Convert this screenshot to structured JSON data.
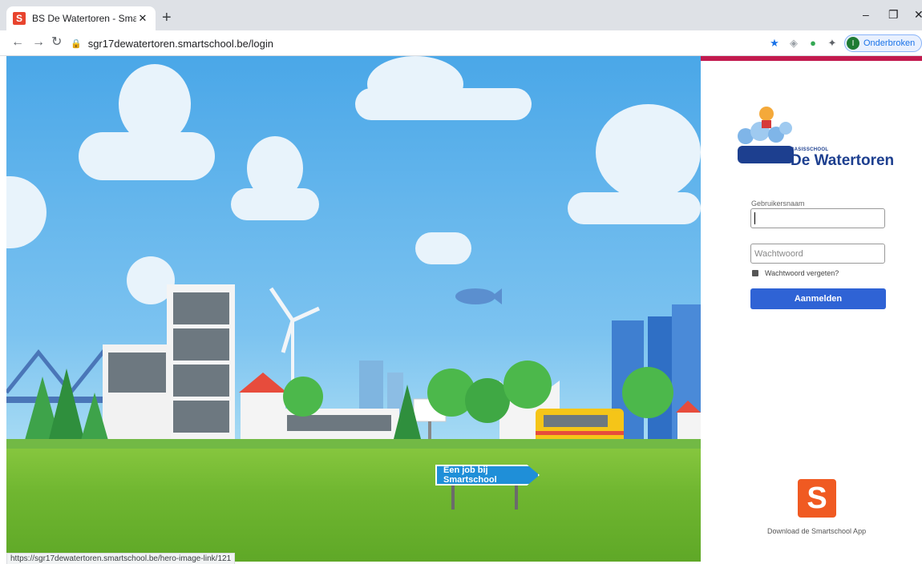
{
  "browser": {
    "tab_title": "BS De Watertoren - Smartschool",
    "tab_favicon": "S",
    "new_tab": "+",
    "url": "sgr17dewatertoren.smartschool.be/login",
    "profile_label": "Onderbroken",
    "profile_initial": "I"
  },
  "hero": {
    "sign_text": "Een job bij Smartschool",
    "status_url": "https://sgr17dewatertoren.smartschool.be/hero-image-link/121"
  },
  "login": {
    "logo_small": "BASISSCHOOL",
    "logo_big": "De Watertoren",
    "username_label": "Gebruikersnaam",
    "password_placeholder": "Wachtwoord",
    "forgot_label": "Wachtwoord vergeten?",
    "submit_label": "Aanmelden",
    "app_icon_letter": "S",
    "app_label": "Download de Smartschool App"
  },
  "colors": {
    "accent_bar": "#c21a4e",
    "button": "#2f63d5",
    "app_icon": "#f05a22",
    "logo_text": "#1d3f8f"
  }
}
